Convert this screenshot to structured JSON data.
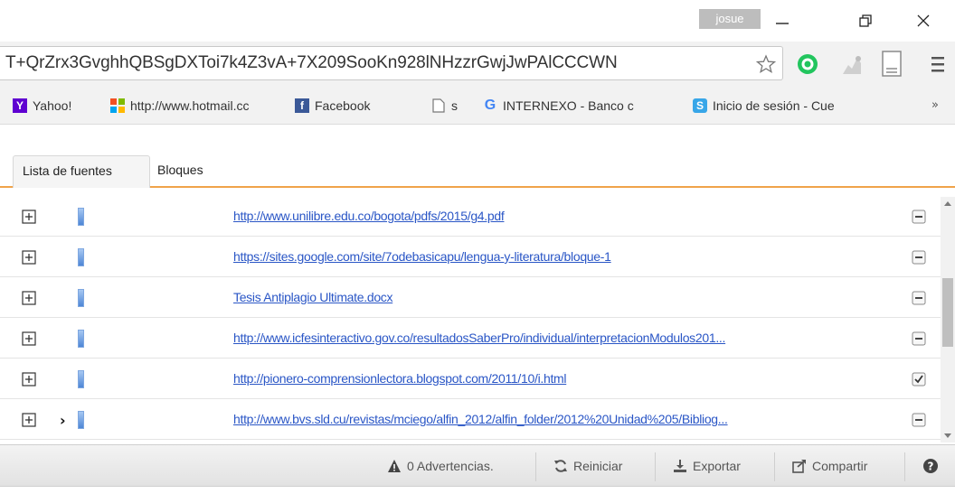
{
  "window": {
    "user": "josue"
  },
  "address_bar": {
    "url": "T+QrZrx3GvghhQBSgDXToi7k4Z3vA+7X209SooKn928lNHzzrGwjJwPAlCCCWN"
  },
  "bookmarks": [
    {
      "label": "Yahoo!",
      "icon": "yahoo-icon"
    },
    {
      "label": "http://www.hotmail.cc",
      "icon": "windows-icon"
    },
    {
      "label": "Facebook",
      "icon": "facebook-icon"
    },
    {
      "label": "s",
      "icon": "page-icon"
    },
    {
      "label": "INTERNEXO - Banco c",
      "icon": "google-icon"
    },
    {
      "label": "Inicio de sesión - Cue",
      "icon": "skype-icon"
    }
  ],
  "bookmarks_more": "»",
  "tabs": [
    {
      "label": "Lista de fuentes",
      "active": true
    },
    {
      "label": "Bloques",
      "active": false
    }
  ],
  "sources": [
    {
      "url": "http://www.unilibre.edu.co/bogota/pdfs/2015/g4.pdf",
      "checked": false,
      "pointer": false
    },
    {
      "url": "https://sites.google.com/site/7odebasicapu/lengua-y-literatura/bloque-1",
      "checked": false,
      "pointer": false
    },
    {
      "url": "Tesis Antiplagio Ultimate.docx",
      "checked": false,
      "pointer": false
    },
    {
      "url": "http://www.icfesinteractivo.gov.co/resultadosSaberPro/individual/interpretacionModulos201...",
      "checked": false,
      "pointer": false
    },
    {
      "url": "http://pionero-comprensionlectora.blogspot.com/2011/10/i.html",
      "checked": true,
      "pointer": false
    },
    {
      "url": "http://www.bvs.sld.cu/revistas/mciego/alfin_2012/alfin_folder/2012%20Unidad%205/Bibliog...",
      "checked": false,
      "pointer": true
    }
  ],
  "toolbar": {
    "warnings": "0 Advertencias.",
    "restart": "Reiniciar",
    "export": "Exportar",
    "share": "Compartir"
  },
  "colors": {
    "accent": "#f0a34a",
    "link": "#2a56c6"
  }
}
